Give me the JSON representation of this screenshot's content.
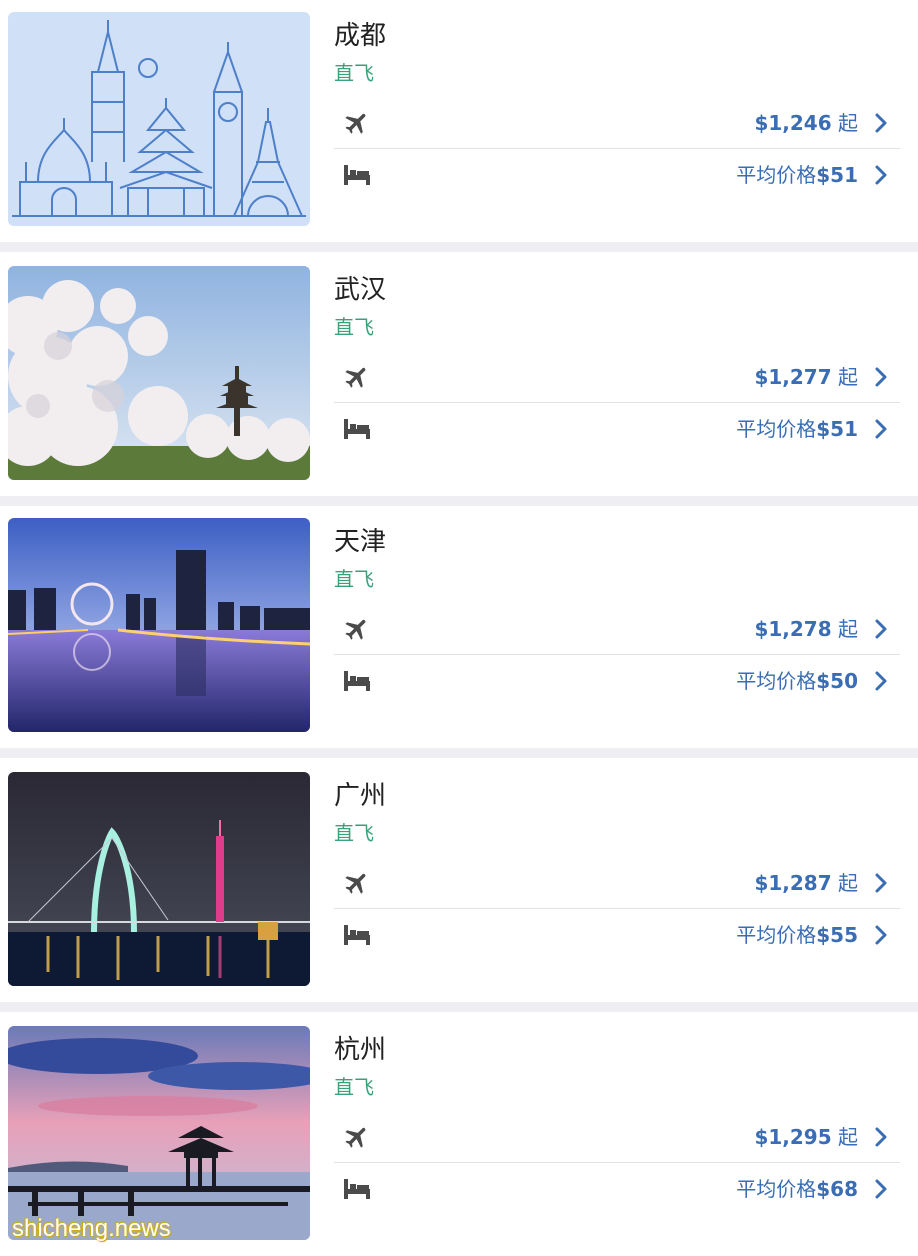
{
  "destinations": [
    {
      "city": "成都",
      "tag": "直飞",
      "flight_price": "$1,246",
      "flight_suffix": " 起",
      "hotel_prefix": "平均价格",
      "hotel_price": "$51"
    },
    {
      "city": "武汉",
      "tag": "直飞",
      "flight_price": "$1,277",
      "flight_suffix": " 起",
      "hotel_prefix": "平均价格",
      "hotel_price": "$51"
    },
    {
      "city": "天津",
      "tag": "直飞",
      "flight_price": "$1,278",
      "flight_suffix": " 起",
      "hotel_prefix": "平均价格",
      "hotel_price": "$50"
    },
    {
      "city": "广州",
      "tag": "直飞",
      "flight_price": "$1,287",
      "flight_suffix": " 起",
      "hotel_prefix": "平均价格",
      "hotel_price": "$55"
    },
    {
      "city": "杭州",
      "tag": "直飞",
      "flight_price": "$1,295",
      "flight_suffix": " 起",
      "hotel_prefix": "平均价格",
      "hotel_price": "$68"
    }
  ],
  "icons": {
    "flight": "airplane-icon",
    "hotel": "bed-icon",
    "chevron": "chevron-right-icon"
  },
  "colors": {
    "price": "#3a6db3",
    "tag": "#3aa27a",
    "city": "#222222",
    "separator": "#efeff3"
  },
  "watermark": "shicheng.news"
}
